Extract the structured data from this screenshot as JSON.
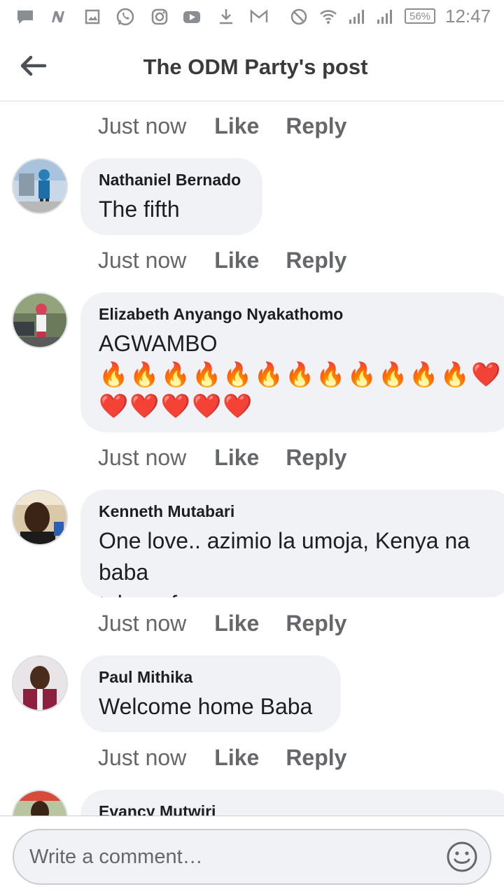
{
  "status_bar": {
    "battery": "56%",
    "time": "12:47"
  },
  "header": {
    "title": "The ODM Party's post"
  },
  "actions": {
    "time": "Just now",
    "like": "Like",
    "reply": "Reply"
  },
  "comments": [
    {
      "author": "Nathaniel Bernado",
      "text": "The fifth"
    },
    {
      "author": "Elizabeth Anyango Nyakathomo",
      "text": "AGWAMBO",
      "emoji_line_1": "🔥🔥🔥🔥🔥🔥🔥🔥🔥🔥🔥🔥❤️",
      "emoji_line_2": "❤️❤️❤️❤️❤️"
    },
    {
      "author": "Kenneth Mutabari",
      "text": "One love.. azimio la umoja, Kenya na baba\ntuko safe."
    },
    {
      "author": "Paul Mithika",
      "text": "Welcome home Baba"
    },
    {
      "author": "Evancy Mutwiri"
    }
  ],
  "composer": {
    "placeholder": "Write a comment…"
  },
  "colors": {
    "bubble": "#f0f2f5",
    "secondary_text": "#65676b",
    "primary_text": "#1c1e21"
  }
}
